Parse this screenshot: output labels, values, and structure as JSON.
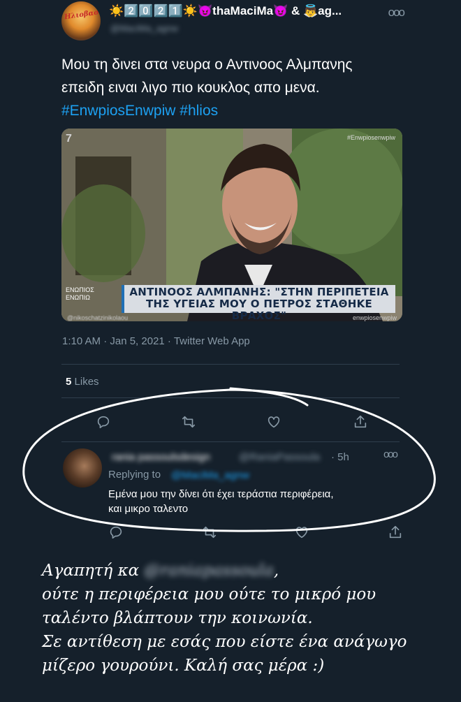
{
  "header": {
    "display_name": "☀️2️⃣0️⃣2️⃣1️⃣☀️😈thaΜaciΜa😈 & 👼ag...",
    "handle": "@ΜaciΜa_agnw",
    "avatar_text": "Ηλιοβασίλεμα",
    "more_icon": "ooo"
  },
  "tweet": {
    "text_plain": "Μου τη δινει στα νευρα ο Αντινοος Αλμπανης επειδη ειναι λιγο πιο κουκλος απο μενα.",
    "hashtags": [
      "#EnwpiosEnwpiw",
      "#hlios"
    ],
    "timestamp": "1:10 AM · Jan 5, 2021 · Twitter Web App",
    "likes_count": "5",
    "likes_label": "Likes"
  },
  "media": {
    "logo": "7",
    "watermark": "#Enwpiosenwpiw",
    "show_logo_line1": "ΕΝΩΠΙΟΣ",
    "show_logo_line2": "ΕΝΩΠΙΩ",
    "headline_line1": "ΑΝΤΙΝΟΟΣ ΑΛΜΠΑΝΗΣ: \"ΣΤΗΝ ΠΕΡΙΠΕΤΕΙΑ",
    "headline_line2": "ΤΗΣ ΥΓΕΙΑΣ ΜΟΥ Ο ΠΕΤΡΟΣ ΣΤΑΘΗΚΕ ΒΡΑΧΟΣ\"",
    "credit_left": "@nikoschatzinikolaou",
    "credit_right": "enwpiosenwpiw"
  },
  "actions": {
    "icons": [
      "reply-icon",
      "retweet-icon",
      "like-icon",
      "share-icon"
    ]
  },
  "reply": {
    "name": "rania passoulsdesign",
    "handle": "@RaniaPassoula",
    "time": "· 5h",
    "replying_to_label": "Replying to",
    "replying_to_handle": "@ΜaciΜa_agnw",
    "text_line1": "Εμένα μου την δίνει ότι έχει τεράστια περιφέρεια,",
    "text_line2": "και μικρο ταλεντο"
  },
  "caption": {
    "line1_prefix": "Αγαπητή κα",
    "line1_blurred": "@raniapassoula",
    "line1_suffix": ",",
    "line2": "ούτε η περιφέρεια μου ούτε το μικρό μου",
    "line3": "ταλέντο βλάπτουν την κοινωνία.",
    "line4": "Σε αντίθεση με εσάς που είστε ένα ανάγωγο",
    "line5": "μίζερο γουρούνι. Καλή σας μέρα :)"
  },
  "colors": {
    "background": "#15202b",
    "accent": "#1da1f2",
    "muted": "#8899a6",
    "divider": "#2f3e4d"
  }
}
